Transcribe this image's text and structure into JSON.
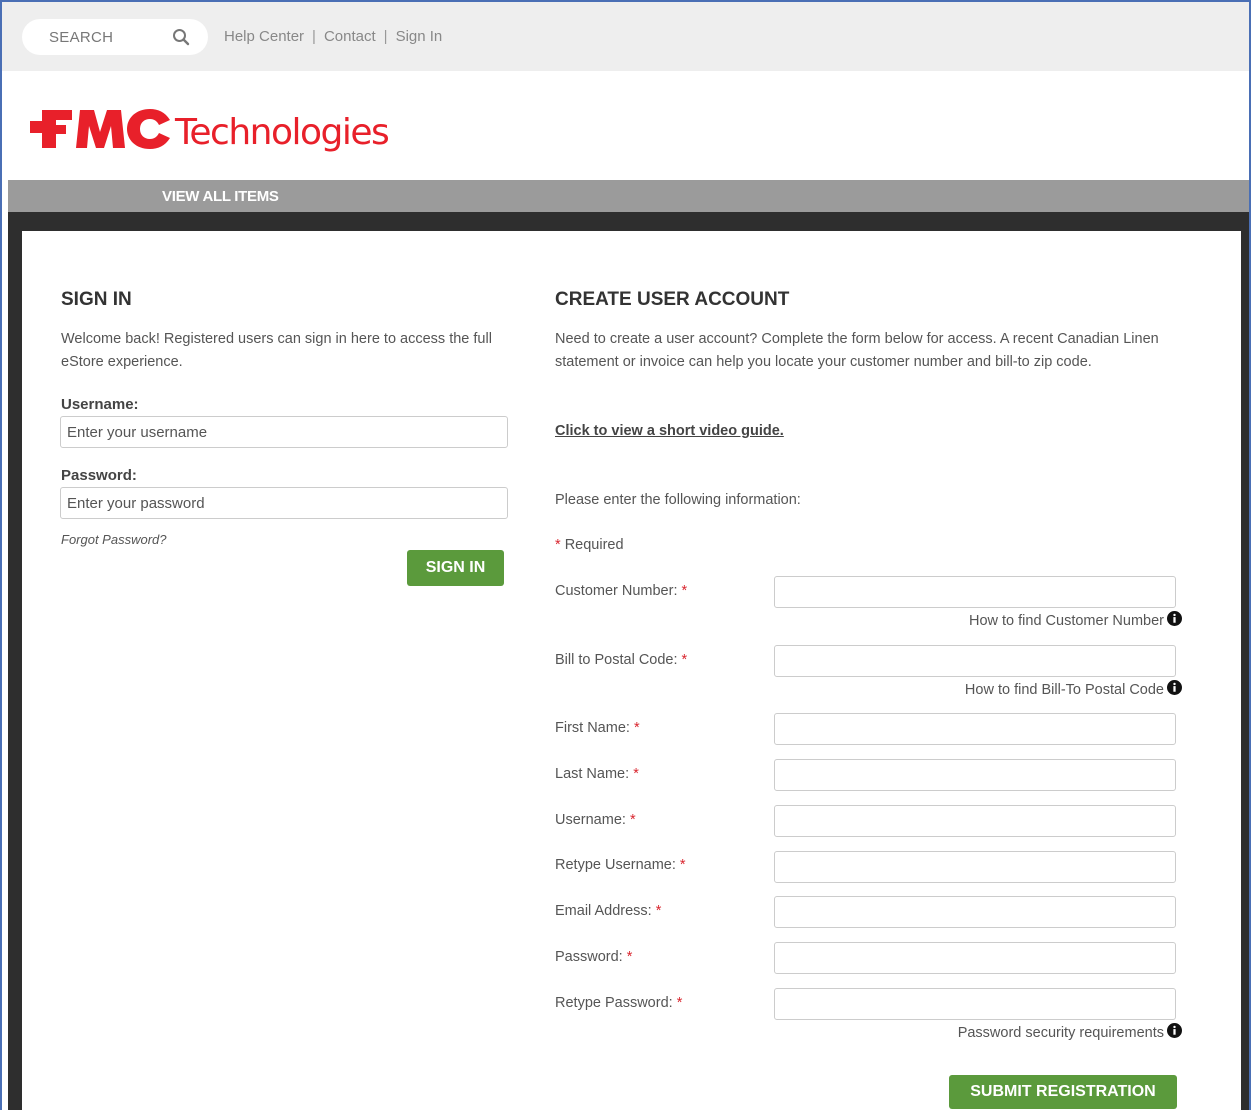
{
  "utility": {
    "search_placeholder": "SEARCH",
    "links": [
      "Help Center",
      "Contact",
      "Sign In"
    ]
  },
  "logo": {
    "mark": "FMC",
    "text": "Technologies",
    "color": "#e8202a"
  },
  "nav": {
    "items": [
      "VIEW ALL ITEMS"
    ]
  },
  "signin": {
    "title": "SIGN IN",
    "intro": "Welcome back! Registered users can sign in here to access the full eStore experience.",
    "username_label": "Username:",
    "username_placeholder": "Enter your username",
    "password_label": "Password:",
    "password_placeholder": "Enter your password",
    "forgot": "Forgot Password?",
    "button": "SIGN IN"
  },
  "register": {
    "title": "CREATE USER ACCOUNT",
    "intro": "Need to create a user account? Complete the form below for access. A recent Canadian Linen statement or invoice can help you locate your customer number and bill-to zip code.",
    "video_link": "Click to view a short video guide.",
    "instructions": "Please enter the following information:",
    "required_mark": "*",
    "required_text": "Required",
    "fields": [
      {
        "label": "Customer Number:",
        "help": "How to find Customer Number"
      },
      {
        "label": "Bill to Postal Code:",
        "help": "How to find Bill-To Postal Code"
      },
      {
        "label": "First Name:"
      },
      {
        "label": "Last Name:"
      },
      {
        "label": "Username:"
      },
      {
        "label": "Retype Username:"
      },
      {
        "label": "Email Address:"
      },
      {
        "label": "Password:"
      },
      {
        "label": "Retype Password:",
        "help": "Password security requirements"
      }
    ],
    "submit": "SUBMIT REGISTRATION"
  },
  "colors": {
    "accent_green": "#5b9a3c",
    "brand_red": "#e8202a",
    "nav_gray": "#9b9b9b",
    "dark_bg": "#2e2e2e"
  }
}
